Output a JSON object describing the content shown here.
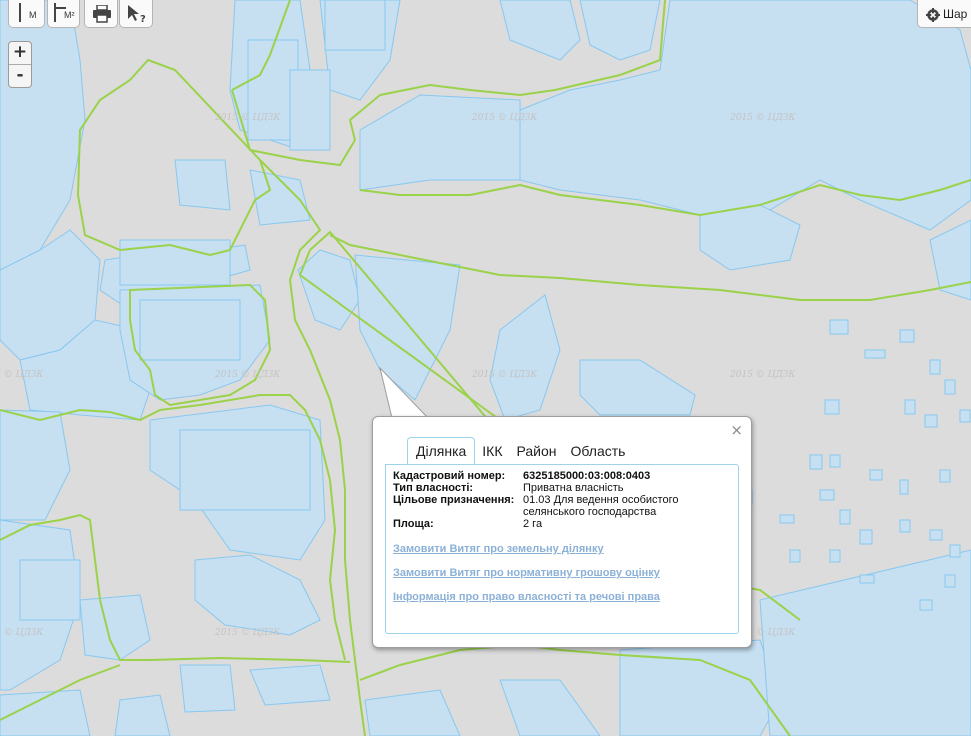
{
  "toolbar": {
    "measure_length_label": "М",
    "measure_area_label": "М²"
  },
  "zoom": {
    "in_label": "+",
    "out_label": "-"
  },
  "layers_button": {
    "label": "Шар"
  },
  "watermark": "2015 © ЦДЗК",
  "popup": {
    "close_label": "×",
    "tabs": [
      {
        "label": "Ділянка",
        "active": true
      },
      {
        "label": "ІКК",
        "active": false
      },
      {
        "label": "Район",
        "active": false
      },
      {
        "label": "Область",
        "active": false
      }
    ],
    "fields": [
      {
        "key": "Кадастровий номер:",
        "value": "6325185000:03:008:0403"
      },
      {
        "key": "Тип власності:",
        "value": "Приватна власність"
      },
      {
        "key": "Цільове призначення:",
        "value": "01.03 Для ведення особистого селянського господарства"
      },
      {
        "key": "Площа:",
        "value": "2 га"
      }
    ],
    "links": [
      "Замовити Витяг про земельну ділянку",
      "Замовити Витяг про нормативну грошову оцінку",
      "Інформація про право власності та речові права"
    ]
  },
  "colors": {
    "background": "#dcdcdc",
    "parcel_fill": "#c6dff1",
    "parcel_stroke": "#88c8f0",
    "boundary": "#9ad24a",
    "link": "#8cb1d7"
  }
}
